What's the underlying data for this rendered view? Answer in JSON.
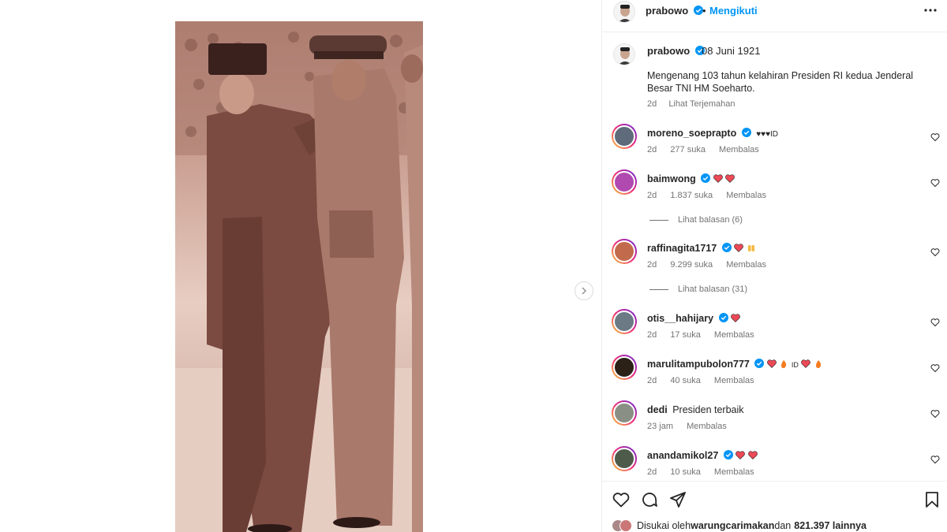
{
  "post": {
    "username": "prabowo",
    "follow_state": "Mengikuti",
    "dot": "•"
  },
  "caption": {
    "username": "prabowo",
    "date": "08 Juni 1921",
    "text": "Mengenang 103 tahun kelahiran Presiden RI kedua Jenderal Besar TNI HM Soeharto.",
    "time": "2d",
    "translate": "Lihat Terjemahan"
  },
  "comments": [
    {
      "username": "moreno_soeprapto",
      "text": "♥♥♥ID",
      "time": "2d",
      "likes": "277 suka",
      "reply": "Membalas"
    },
    {
      "username": "baimwong",
      "text": "",
      "time": "2d",
      "likes": "1.837 suka",
      "reply": "Membalas",
      "view_replies": "Lihat balasan (6)"
    },
    {
      "username": "raffinagita1717",
      "text": "",
      "time": "2d",
      "likes": "9.299 suka",
      "reply": "Membalas",
      "view_replies": "Lihat balasan (31)"
    },
    {
      "username": "otis__hahijary",
      "text": "",
      "time": "2d",
      "likes": "17 suka",
      "reply": "Membalas"
    },
    {
      "username": "marulitampubolon777",
      "text": "ID",
      "time": "2d",
      "likes": "40 suka",
      "reply": "Membalas"
    },
    {
      "username": "dedi",
      "text": "Presiden terbaik",
      "time": "23 jam",
      "likes": "",
      "reply": "Membalas"
    },
    {
      "username": "anandamikol27",
      "text": "",
      "time": "2d",
      "likes": "10 suka",
      "reply": "Membalas"
    }
  ],
  "likes_line": {
    "prefix": "Disukai oleh",
    "user": "warungcarimakan",
    "and": "dan",
    "count": "821.397 lainnya"
  },
  "icons": {
    "verified": "verified-badge-icon",
    "more": "more-options-icon",
    "like": "heart-icon",
    "comment": "comment-icon",
    "share": "share-icon",
    "save": "bookmark-icon",
    "next": "chevron-right-icon"
  },
  "colors": {
    "accent": "#0095f6",
    "heart_red": "#ed4956",
    "photo_sepia": "#e7cbbf"
  }
}
